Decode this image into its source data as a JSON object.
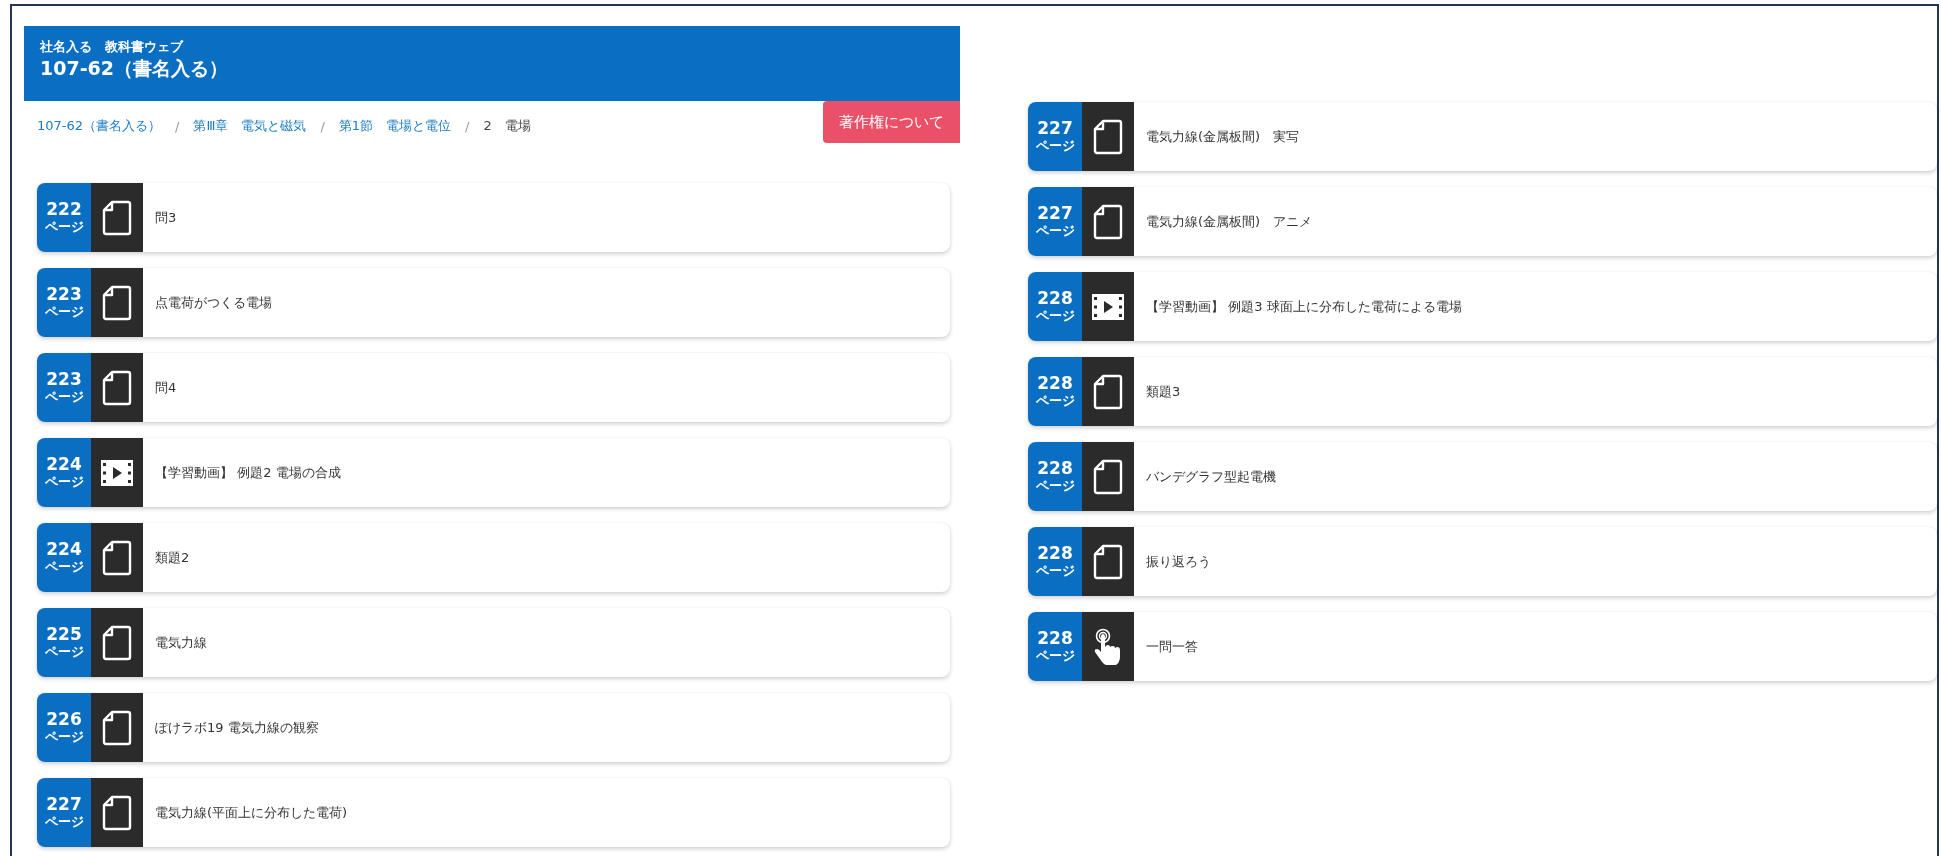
{
  "header": {
    "publisher": "社名入る　教科書ウェブ",
    "title": "107-62（書名入る）"
  },
  "breadcrumb": [
    {
      "kind": "link",
      "label": "107-62（書名入る）"
    },
    {
      "kind": "separator",
      "label": "/"
    },
    {
      "kind": "link",
      "label": "第Ⅲ章　電気と磁気"
    },
    {
      "kind": "separator",
      "label": "/"
    },
    {
      "kind": "link",
      "label": "第1節　電場と電位"
    },
    {
      "kind": "separator",
      "label": "/"
    },
    {
      "kind": "current",
      "label": "2　電場"
    }
  ],
  "copyright_button": "著作権について",
  "columns": [
    {
      "items": [
        {
          "page": "222",
          "unit": "ページ",
          "kind": "document",
          "title": "問3"
        },
        {
          "page": "223",
          "unit": "ページ",
          "kind": "document",
          "title": "点電荷がつくる電場"
        },
        {
          "page": "223",
          "unit": "ページ",
          "kind": "document",
          "title": "問4"
        },
        {
          "page": "224",
          "unit": "ページ",
          "kind": "video",
          "title": "【学習動画】 例題2 電場の合成"
        },
        {
          "page": "224",
          "unit": "ページ",
          "kind": "document",
          "title": "類題2"
        },
        {
          "page": "225",
          "unit": "ページ",
          "kind": "document",
          "title": "電気力線"
        },
        {
          "page": "226",
          "unit": "ページ",
          "kind": "document",
          "title": "ぽけラボ19 電気力線の観察"
        },
        {
          "page": "227",
          "unit": "ページ",
          "kind": "document",
          "title": "電気力線(平面上に分布した電荷)"
        }
      ]
    },
    {
      "items": [
        {
          "page": "227",
          "unit": "ページ",
          "kind": "document",
          "title": "電気力線(金属板間)　実写"
        },
        {
          "page": "227",
          "unit": "ページ",
          "kind": "document",
          "title": "電気力線(金属板間)　アニメ"
        },
        {
          "page": "228",
          "unit": "ページ",
          "kind": "video",
          "title": "【学習動画】 例題3 球面上に分布した電荷による電場"
        },
        {
          "page": "228",
          "unit": "ページ",
          "kind": "document",
          "title": "類題3"
        },
        {
          "page": "228",
          "unit": "ページ",
          "kind": "document",
          "title": "バンデグラフ型起電機"
        },
        {
          "page": "228",
          "unit": "ページ",
          "kind": "document",
          "title": "振り返ろう"
        },
        {
          "page": "228",
          "unit": "ページ",
          "kind": "interactive",
          "title": "一問一答"
        }
      ]
    }
  ]
}
